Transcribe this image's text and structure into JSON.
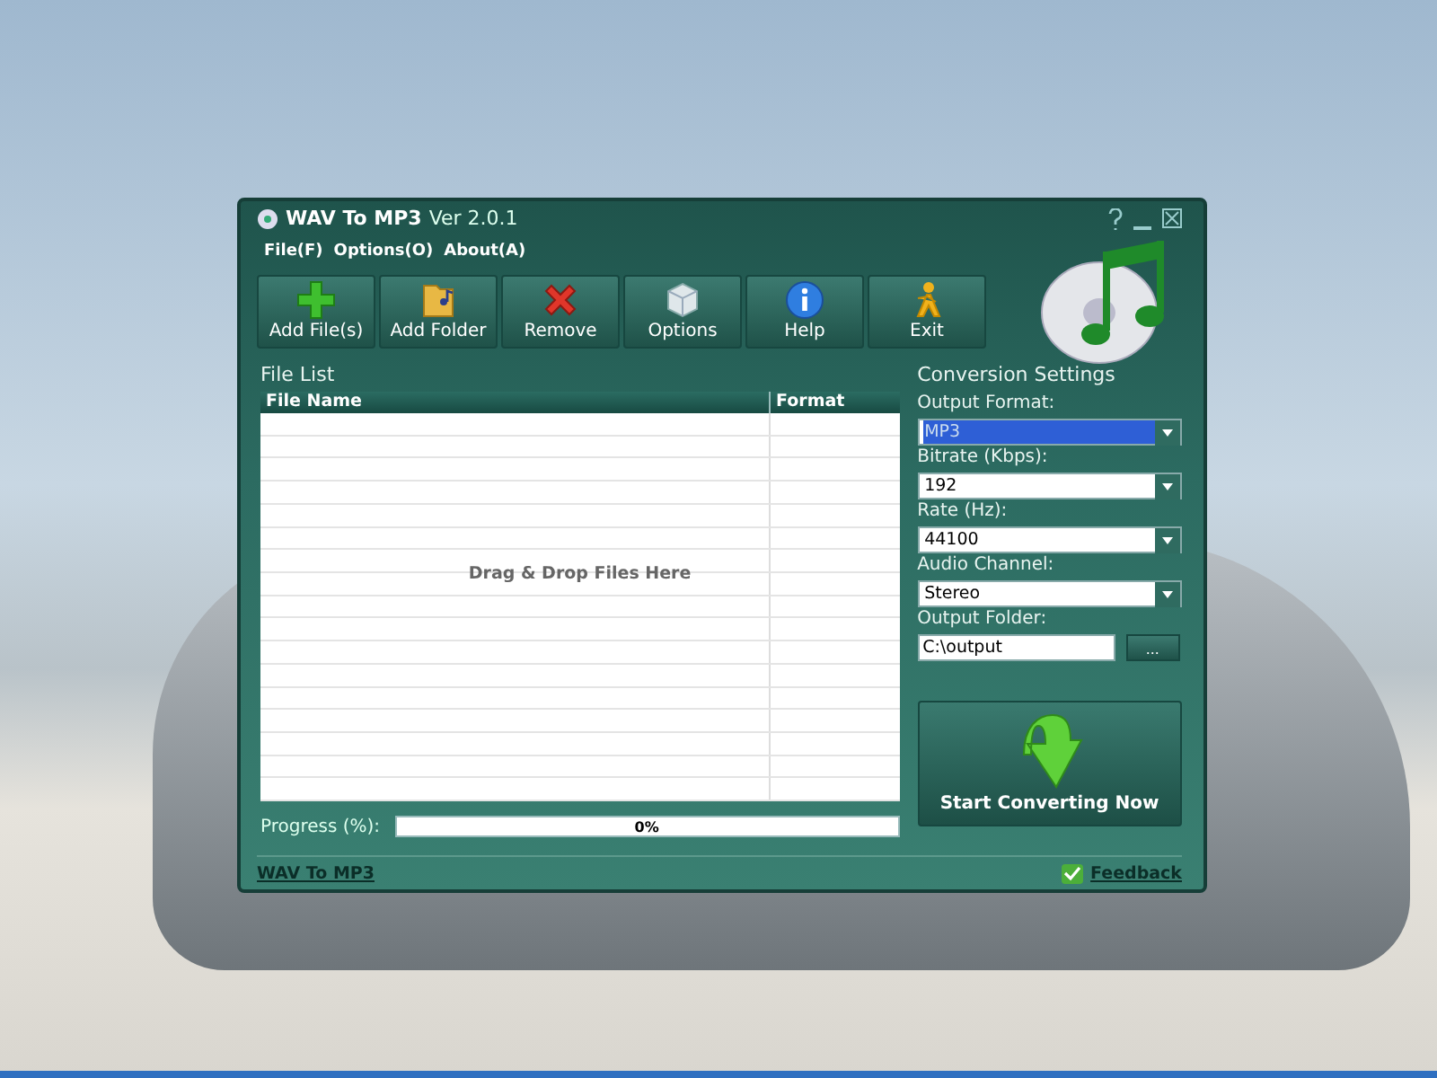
{
  "window": {
    "title": "WAV To MP3",
    "version": "Ver 2.0.1"
  },
  "menu": [
    {
      "label": "File(F)"
    },
    {
      "label": "Options(O)"
    },
    {
      "label": "About(A)"
    }
  ],
  "toolbar": [
    {
      "label": "Add File(s)",
      "kind": "add"
    },
    {
      "label": "Add Folder",
      "kind": "folder"
    },
    {
      "label": "Remove",
      "kind": "remove"
    },
    {
      "label": "Options",
      "kind": "options"
    },
    {
      "label": "Help",
      "kind": "help"
    },
    {
      "label": "Exit",
      "kind": "exit"
    }
  ],
  "file_list": {
    "title": "File List",
    "columns": [
      "File Name",
      "Format"
    ],
    "placeholder": "Drag & Drop Files Here"
  },
  "progress": {
    "label": "Progress (%):",
    "level": 0,
    "reading": "0%"
  },
  "settings": {
    "title": "Conversion Settings",
    "fields": [
      {
        "label": "Output Format:",
        "value": "MP3",
        "kind": "dropdown",
        "focused": true
      },
      {
        "label": "Bitrate (Kbps):",
        "value": "192",
        "kind": "dropdown",
        "focused": false
      },
      {
        "label": "Rate (Hz):",
        "value": "44100",
        "kind": "dropdown",
        "focused": false
      },
      {
        "label": "Audio Channel:",
        "value": "Stereo",
        "kind": "dropdown",
        "focused": false
      },
      {
        "label": "Output Folder:",
        "value": "C:\\output",
        "kind": "folder",
        "button": "..."
      }
    ]
  },
  "convert_button": "Start Converting Now",
  "footer": {
    "link": "WAV To MP3",
    "feedback": "Feedback"
  }
}
